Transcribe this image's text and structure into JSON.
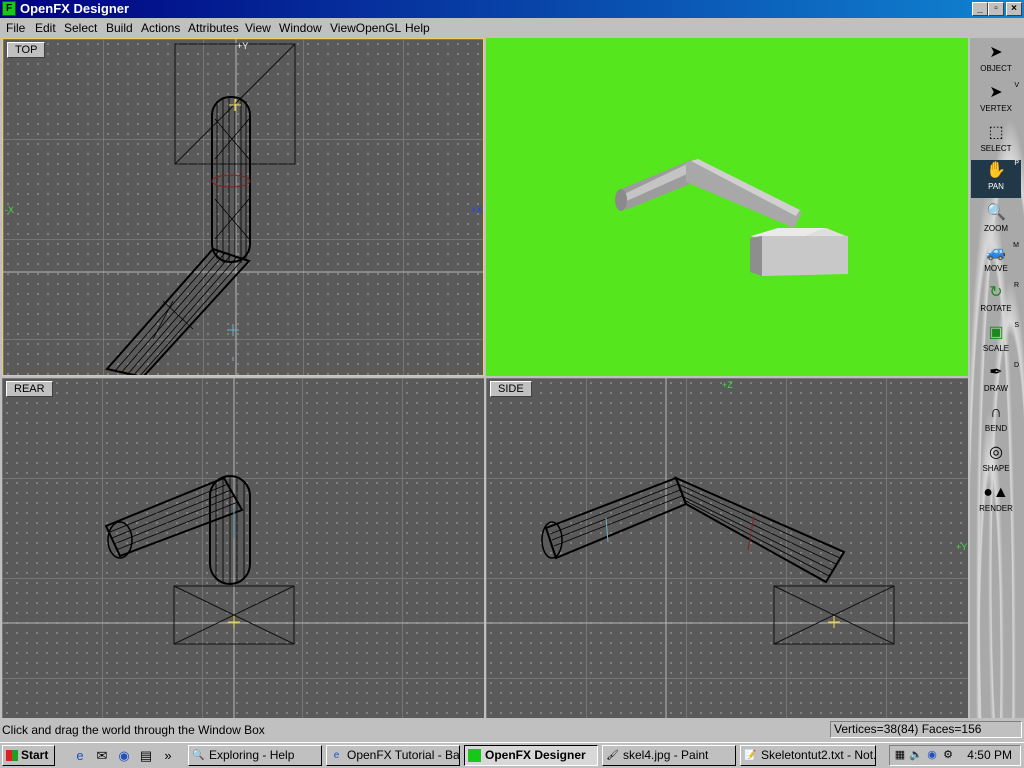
{
  "window": {
    "title": "OpenFX Designer",
    "icon": "openfx-app-icon"
  },
  "window_buttons": [
    "minimize",
    "maximize",
    "close"
  ],
  "menu": [
    "File",
    "Edit",
    "Select",
    "Build",
    "Actions",
    "Attributes",
    "View",
    "Window",
    "ViewOpenGL",
    "Help"
  ],
  "viewports": {
    "top": {
      "label": "TOP",
      "axes": {
        "y": "+Y",
        "x_left": "-X",
        "x_right": "+X"
      }
    },
    "rear": {
      "label": "REAR"
    },
    "side": {
      "label": "SIDE",
      "axes": {
        "z": "+Z",
        "y": "+Y"
      }
    },
    "render": {
      "background": "#55e61e"
    }
  },
  "tools": [
    {
      "label": "OBJECT",
      "icon": "arrow-cursor-icon",
      "hotkey": ""
    },
    {
      "label": "VERTEX",
      "icon": "vertex-cursor-icon",
      "hotkey": "V"
    },
    {
      "label": "SELECT",
      "icon": "select-box-icon",
      "hotkey": ""
    },
    {
      "label": "PAN",
      "icon": "hand-icon",
      "hotkey": "P"
    },
    {
      "label": "ZOOM",
      "icon": "magnifier-icon",
      "hotkey": ""
    },
    {
      "label": "MOVE",
      "icon": "move-car-icon",
      "hotkey": "M"
    },
    {
      "label": "ROTATE",
      "icon": "rotate-icon",
      "hotkey": "R"
    },
    {
      "label": "SCALE",
      "icon": "scale-icon",
      "hotkey": "S"
    },
    {
      "label": "DRAW",
      "icon": "pen-icon",
      "hotkey": "D"
    },
    {
      "label": "BEND",
      "icon": "magnet-icon",
      "hotkey": ""
    },
    {
      "label": "SHAPE",
      "icon": "shape-icon",
      "hotkey": ""
    },
    {
      "label": "RENDER",
      "icon": "render-icon",
      "hotkey": ""
    }
  ],
  "active_tool": "PAN",
  "status": {
    "message": "Click and drag the world through the Window Box",
    "counts": "Vertices=38(84) Faces=156"
  },
  "taskbar": {
    "start": "Start",
    "tasks": [
      {
        "label": "Exploring - Help",
        "icon": "explorer-icon"
      },
      {
        "label": "OpenFX Tutorial - Ba...",
        "icon": "ie-icon"
      },
      {
        "label": "OpenFX Designer",
        "icon": "openfx-icon",
        "active": true
      },
      {
        "label": "skel4.jpg - Paint",
        "icon": "paint-icon"
      },
      {
        "label": "Skeletontut2.txt - Not...",
        "icon": "notepad-icon"
      }
    ],
    "clock": "4:50 PM"
  },
  "colors": {
    "render_bg": "#55e61e",
    "title_blue": "#000080",
    "active_tool": "#203848"
  }
}
